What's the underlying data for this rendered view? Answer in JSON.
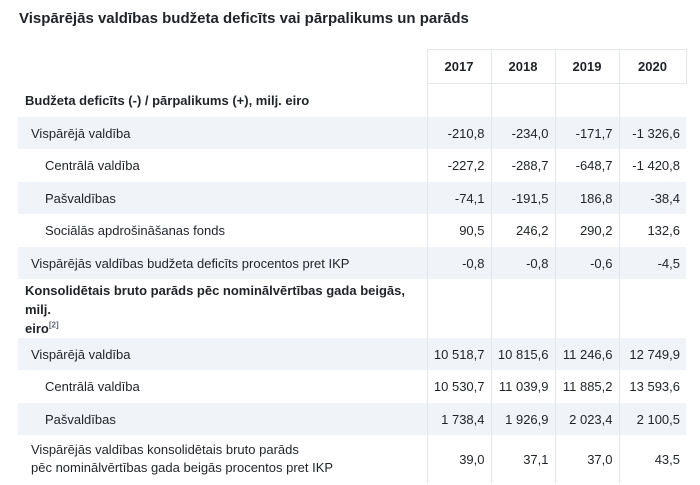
{
  "title": "Vispārējās valdības budžeta deficīts vai pārpalikums un parāds",
  "years": [
    "2017",
    "2018",
    "2019",
    "2020"
  ],
  "section1": {
    "heading": "Budžeta deficīts (-) / pārpalikums (+), milj. eiro",
    "rows": [
      {
        "label": "Vispārējā valdība",
        "values": [
          "-210,8",
          "-234,0",
          "-171,7",
          "-1 326,6"
        ]
      },
      {
        "label": "Centrālā valdība",
        "values": [
          "-227,2",
          "-288,7",
          "-648,7",
          "-1 420,8"
        ]
      },
      {
        "label": "Pašvaldības",
        "values": [
          "-74,1",
          "-191,5",
          "186,8",
          "-38,4"
        ]
      },
      {
        "label": "Sociālās apdrošināšanas fonds",
        "values": [
          "90,5",
          "246,2",
          "290,2",
          "132,6"
        ]
      },
      {
        "label": "Vispārējās valdības budžeta deficīts procentos pret IKP",
        "values": [
          "-0,8",
          "-0,8",
          "-0,6",
          "-4,5"
        ]
      }
    ]
  },
  "section2": {
    "heading_line1": "Konsolidētais bruto parāds pēc nominālvērtības gada beigās, milj.",
    "heading_line2": "eiro",
    "footnote": "[2]",
    "rows": [
      {
        "label": "Vispārējā valdība",
        "values": [
          "10 518,7",
          "10 815,6",
          "11 246,6",
          "12 749,9"
        ]
      },
      {
        "label": "Centrālā valdība",
        "values": [
          "10 530,7",
          "11 039,9",
          "11 885,2",
          "13 593,6"
        ]
      },
      {
        "label": "Pašvaldības",
        "values": [
          "1 738,4",
          "1 926,9",
          "2 023,4",
          "2 100,5"
        ]
      }
    ],
    "last_row": {
      "label_line1": "Vispārējās valdības konsolidētais bruto parāds",
      "label_line2": "pēc nominālvērtības gada beigās procentos pret IKP",
      "values": [
        "39,0",
        "37,1",
        "37,0",
        "43,5"
      ]
    }
  }
}
